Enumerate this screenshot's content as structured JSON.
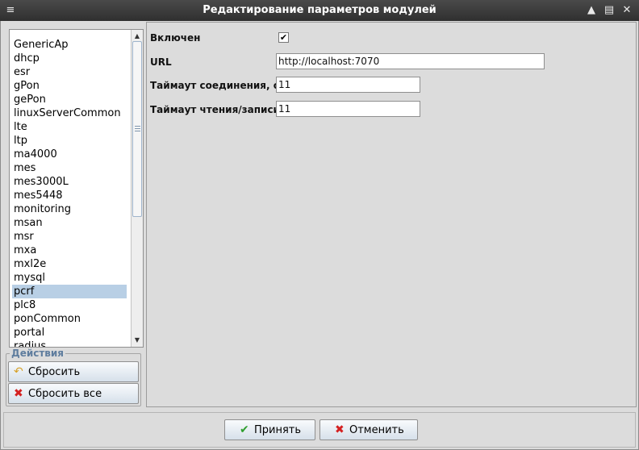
{
  "window": {
    "title": "Редактирование параметров модулей"
  },
  "modules": {
    "items": [
      "GenericAp",
      "dhcp",
      "esr",
      "gPon",
      "gePon",
      "linuxServerCommon",
      "lte",
      "ltp",
      "ma4000",
      "mes",
      "mes3000L",
      "mes5448",
      "monitoring",
      "msan",
      "msr",
      "mxa",
      "mxl2e",
      "mysql",
      "pcrf",
      "plc8",
      "ponCommon",
      "portal",
      "radius"
    ],
    "selected": "pcrf"
  },
  "actions": {
    "legend": "Действия",
    "reset_label": "Сбросить",
    "reset_all_label": "Сбросить все"
  },
  "form": {
    "enabled_label": "Включен",
    "enabled_checked": true,
    "url_label": "URL",
    "url_value": "http://localhost:7070",
    "conn_timeout_label": "Таймаут соединения, с",
    "conn_timeout_value": "11",
    "rw_timeout_label": "Таймаут чтения/записи, с",
    "rw_timeout_value": "11"
  },
  "footer": {
    "accept_label": "Принять",
    "cancel_label": "Отменить"
  },
  "colors": {
    "selection": "#b8cfe5",
    "legend": "#5f7d9e",
    "accept_icon": "#2e9e2e",
    "cancel_icon": "#d42020",
    "reset_icon": "#d7a22a"
  }
}
